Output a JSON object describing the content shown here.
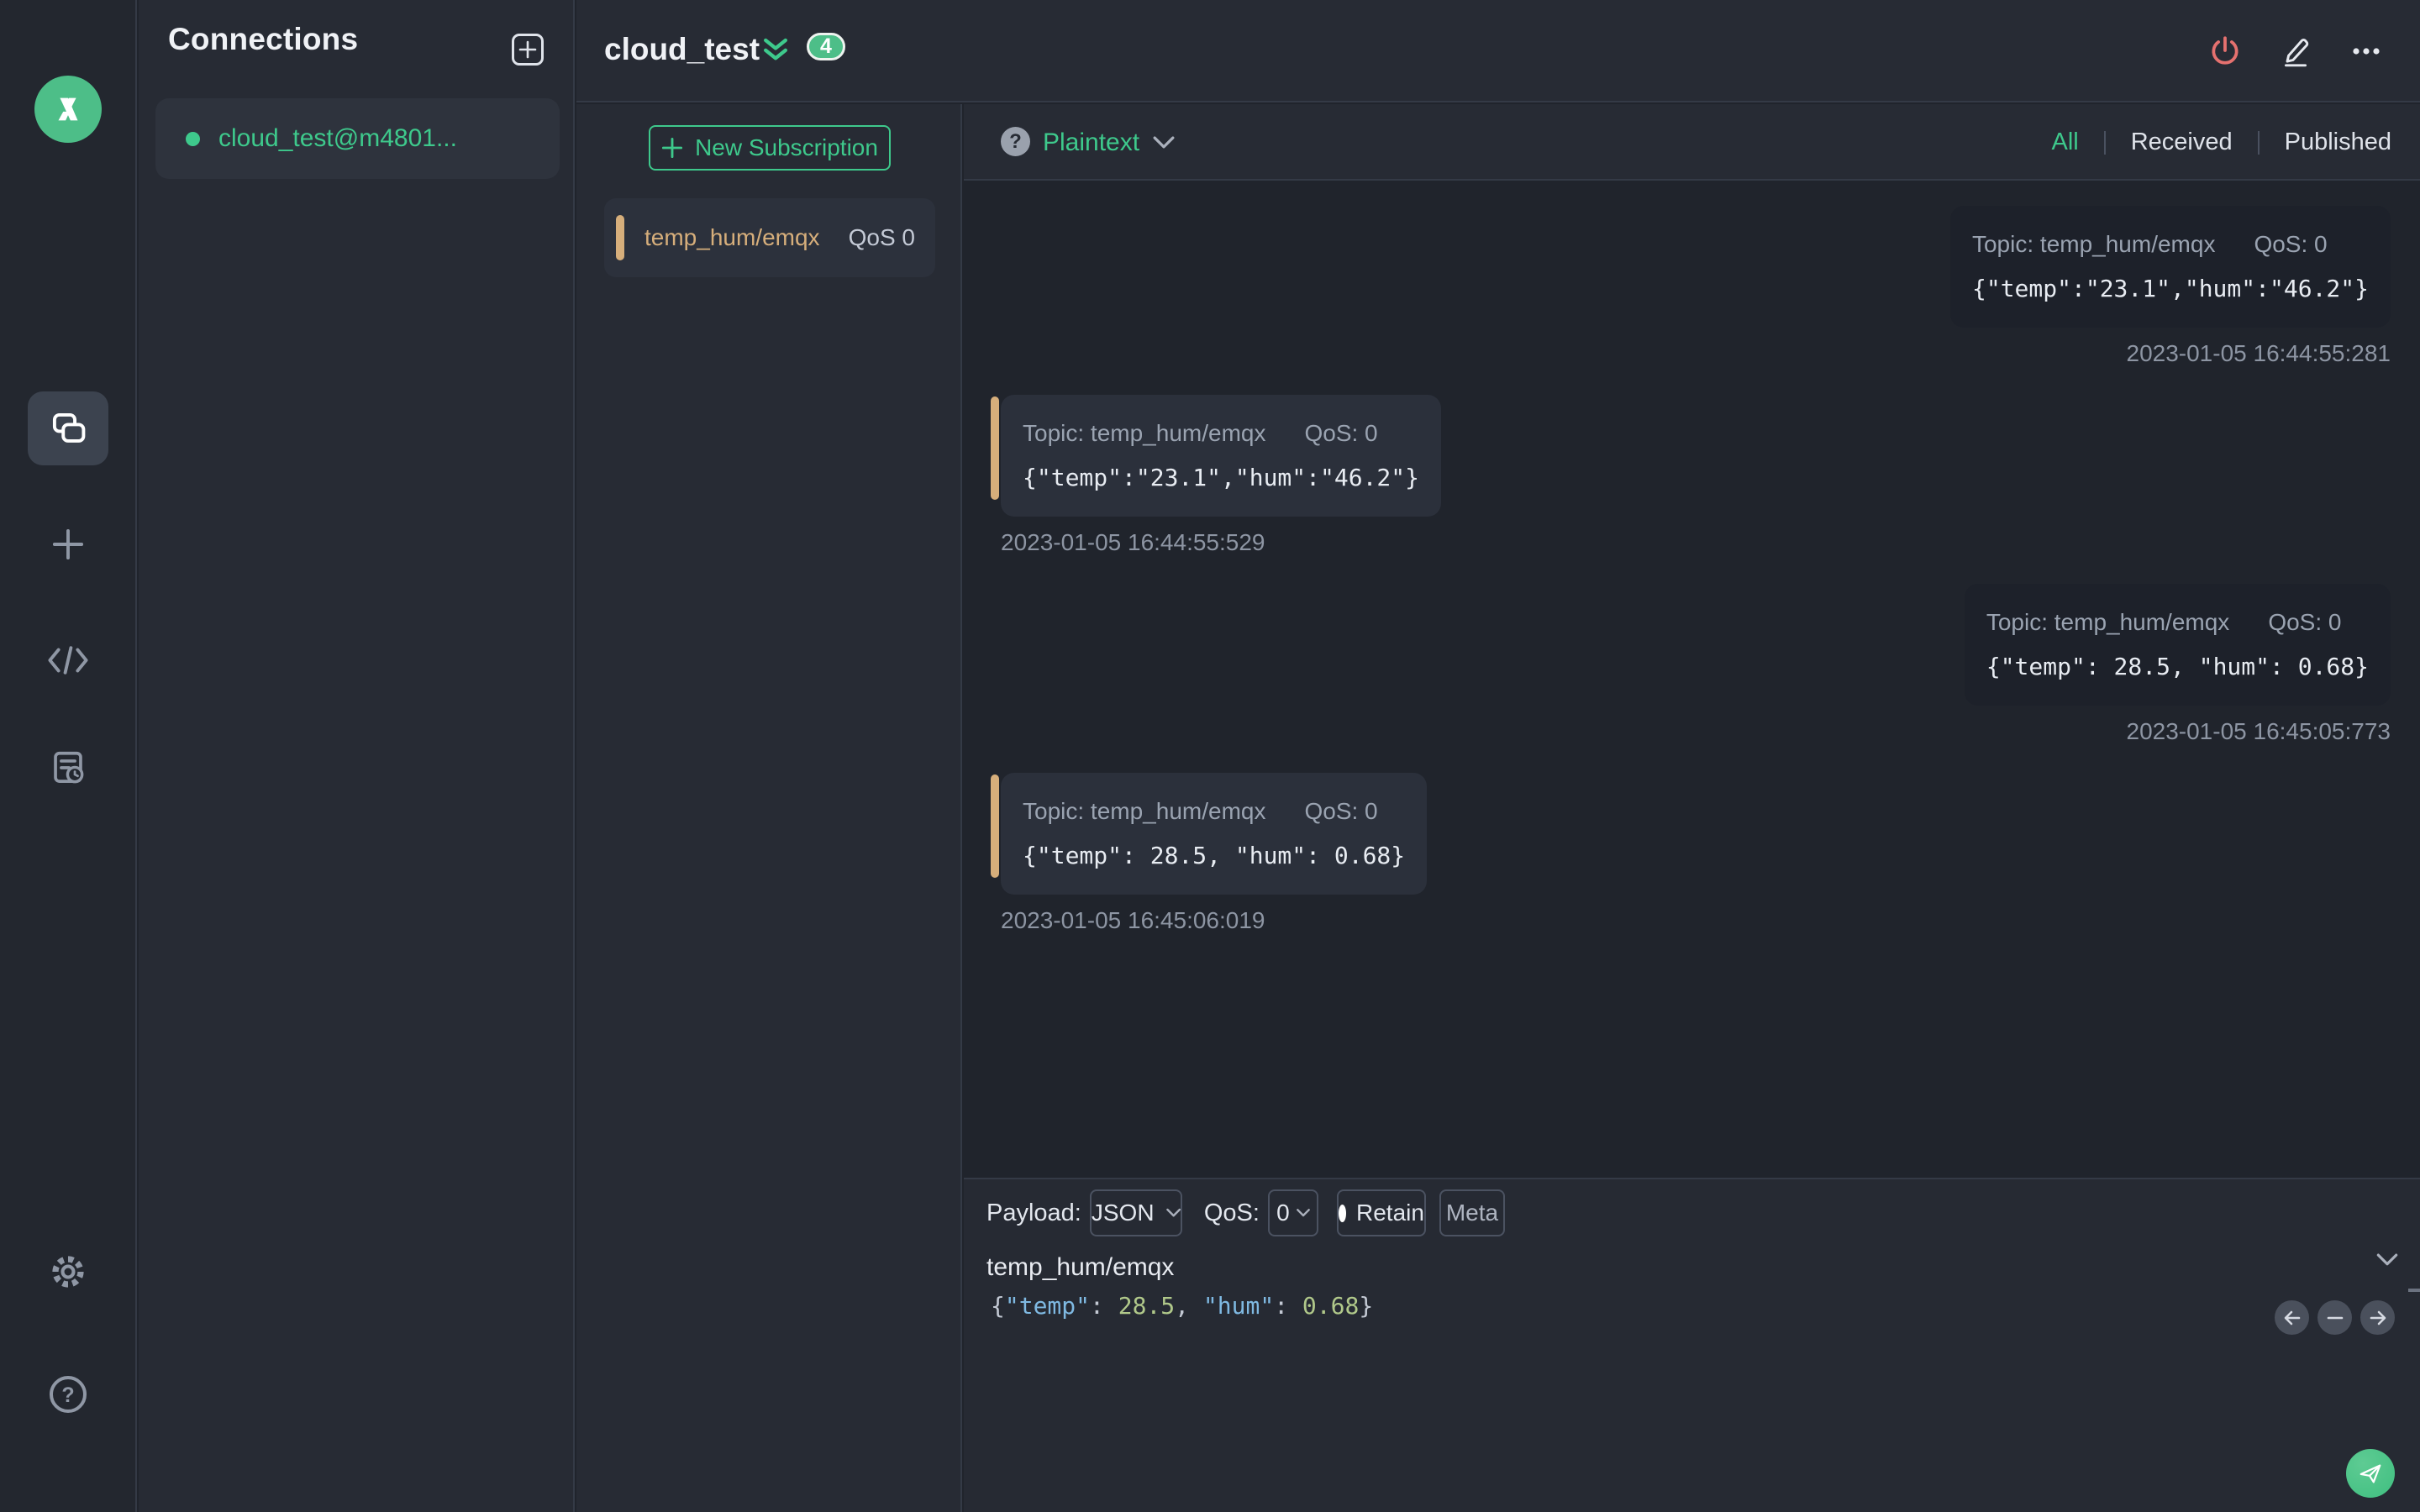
{
  "colors": {
    "accent_green": "#3ec98c",
    "badge_green": "#4dbe88",
    "topic_tan": "#d6ae7b",
    "danger_red": "#e5716f",
    "json_key_blue": "#7fb9e2",
    "json_number_green": "#b0c88a"
  },
  "connections_panel": {
    "title": "Connections",
    "items": [
      {
        "name": "cloud_test@m4801...",
        "selected": true
      }
    ]
  },
  "connection_header": {
    "title": "cloud_test",
    "pending_badge": "4"
  },
  "subscriptions": {
    "new_subscription_label": "New Subscription",
    "items": [
      {
        "topic": "temp_hum/emqx",
        "qos": "QoS 0"
      }
    ]
  },
  "message_toolbar": {
    "format_selector": "Plaintext",
    "filters": [
      {
        "label": "All",
        "active": true
      },
      {
        "label": "Received",
        "active": false
      },
      {
        "label": "Published",
        "active": false
      }
    ]
  },
  "messages": [
    {
      "direction": "published",
      "topic_label": "Topic: temp_hum/emqx",
      "qos_label": "QoS: 0",
      "payload": "{\"temp\":\"23.1\",\"hum\":\"46.2\"}",
      "timestamp": "2023-01-05 16:44:55:281"
    },
    {
      "direction": "received",
      "topic_label": "Topic: temp_hum/emqx",
      "qos_label": "QoS: 0",
      "payload": "{\"temp\":\"23.1\",\"hum\":\"46.2\"}",
      "timestamp": "2023-01-05 16:44:55:529"
    },
    {
      "direction": "published",
      "topic_label": "Topic: temp_hum/emqx",
      "qos_label": "QoS: 0",
      "payload": "{\"temp\": 28.5, \"hum\": 0.68}",
      "timestamp": "2023-01-05 16:45:05:773"
    },
    {
      "direction": "received",
      "topic_label": "Topic: temp_hum/emqx",
      "qos_label": "QoS: 0",
      "payload": "{\"temp\": 28.5, \"hum\": 0.68}",
      "timestamp": "2023-01-05 16:45:06:019"
    }
  ],
  "publish_bar": {
    "payload_label": "Payload:",
    "format_value": "JSON",
    "qos_label": "QoS:",
    "qos_value": "0",
    "retain_label": "Retain",
    "meta_label": "Meta",
    "topic_input": "temp_hum/emqx",
    "payload_tokens": [
      {
        "text": "{",
        "type": "punct"
      },
      {
        "text": "\"temp\"",
        "type": "key"
      },
      {
        "text": ": ",
        "type": "punct"
      },
      {
        "text": "28.5",
        "type": "num"
      },
      {
        "text": ", ",
        "type": "punct"
      },
      {
        "text": "\"hum\"",
        "type": "key"
      },
      {
        "text": ": ",
        "type": "punct"
      },
      {
        "text": "0.68",
        "type": "num"
      },
      {
        "text": "}",
        "type": "punct"
      }
    ]
  }
}
